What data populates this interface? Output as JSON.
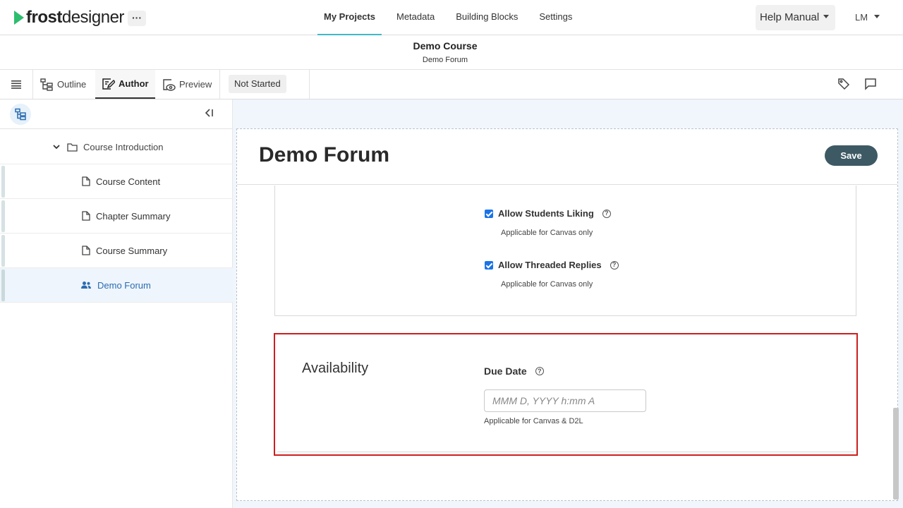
{
  "app": {
    "logo_bold": "frost",
    "logo_light": "designer",
    "more_label": "···"
  },
  "nav": {
    "items": [
      "My Projects",
      "Metadata",
      "Building Blocks",
      "Settings"
    ],
    "active_index": 0
  },
  "help": {
    "label": "Help Manual"
  },
  "user": {
    "initials": "LM"
  },
  "course": {
    "title": "Demo Course",
    "subtitle": "Demo Forum"
  },
  "toolbar": {
    "menu_icon": "hamburger-icon",
    "tabs": [
      {
        "label": "Outline",
        "icon": "outline-tree-icon"
      },
      {
        "label": "Author",
        "icon": "author-edit-icon"
      },
      {
        "label": "Preview",
        "icon": "preview-eye-icon"
      }
    ],
    "active_tab": "Author",
    "status": "Not Started",
    "right_icons": [
      "tag-icon",
      "comment-icon"
    ]
  },
  "sidebar": {
    "collapse_label": "<I",
    "tree": [
      {
        "label": "Course Introduction",
        "type": "folder",
        "expanded": true
      },
      {
        "label": "Course Content",
        "type": "page"
      },
      {
        "label": "Chapter Summary",
        "type": "page"
      },
      {
        "label": "Course Summary",
        "type": "page"
      },
      {
        "label": "Demo Forum",
        "type": "forum",
        "selected": true
      }
    ]
  },
  "editor": {
    "title": "Demo Forum",
    "save_label": "Save",
    "options": [
      {
        "label": "Allow Students Liking",
        "checked": true,
        "note": "Applicable for Canvas only"
      },
      {
        "label": "Allow Threaded Replies",
        "checked": true,
        "note": "Applicable for Canvas only"
      }
    ],
    "availability": {
      "section_title": "Availability",
      "due_date_label": "Due Date",
      "due_date_value": "",
      "due_date_placeholder": "MMM D, YYYY h:mm A",
      "due_date_note": "Applicable for Canvas & D2L"
    }
  },
  "colors": {
    "brand_green": "#2dbd6e",
    "active_tab_underline": "#41b8c5",
    "save_button": "#3d5964",
    "highlight_border": "#cc1f1f",
    "checkbox": "#1a73e8",
    "selected_item_text": "#2b6cb0"
  }
}
